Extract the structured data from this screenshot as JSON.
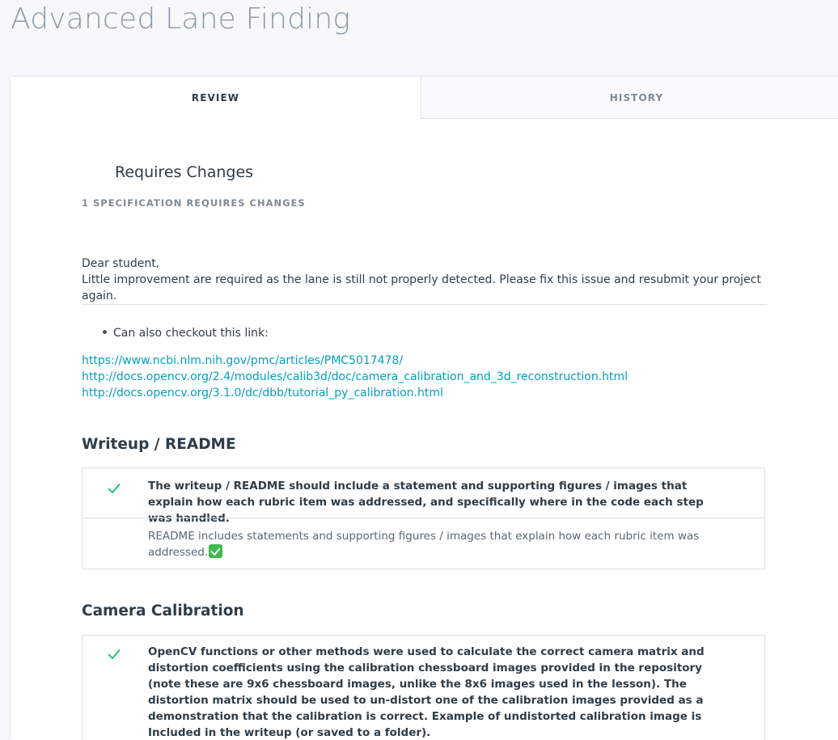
{
  "project": {
    "title": "Advanced Lane Finding"
  },
  "tabs": [
    {
      "label": "REVIEW",
      "active": true
    },
    {
      "label": "HISTORY",
      "active": false
    }
  ],
  "status": {
    "title": "Requires Changes",
    "subtitle": "1 SPECIFICATION REQUIRES CHANGES"
  },
  "summary": {
    "greeting": "Dear student,",
    "message": "Little improvement are required as the lane is still not properly detected. Please fix this issue and resubmit your project again."
  },
  "notes": {
    "bullet": "Can also checkout this link:",
    "links": [
      "https://www.ncbi.nlm.nih.gov/pmc/articles/PMC5017478/",
      "http://docs.opencv.org/2.4/modules/calib3d/doc/camera_calibration_and_3d_reconstruction.html",
      "http://docs.opencv.org/3.1.0/dc/dbb/tutorial_py_calibration.html"
    ]
  },
  "sections": [
    {
      "heading": "Writeup / README",
      "spec": {
        "status": "meets",
        "criterion": "The writeup / README should include a statement and supporting figures / images that explain how each rubric item was addressed, and specifically where in the code each step was handled.",
        "comment": "README includes statements and supporting figures / images that explain how each rubric item was addressed."
      }
    },
    {
      "heading": "Camera Calibration",
      "spec": {
        "status": "meets",
        "criterion": "OpenCV functions or other methods were used to calculate the correct camera matrix and distortion coefficients using the calibration chessboard images provided in the repository (note these are 9x6 chessboard images, unlike the 8x6 images used in the lesson). The distortion matrix should be used to un-distort one of the calibration images provided as a demonstration that the calibration is correct. Example of undistorted calibration image is Included in the writeup (or saved to a folder)."
      }
    }
  ],
  "colors": {
    "accent_link": "#02a0c6",
    "check_green": "#15c26b",
    "emoji_green": "#3dba4e",
    "text_dark": "#2e3d49",
    "text_muted": "#7d8a96",
    "title_gray": "#8a9bac"
  },
  "icons": {
    "meets_spec": "check-icon",
    "inline_emoji": "white-check-mark-emoji"
  }
}
